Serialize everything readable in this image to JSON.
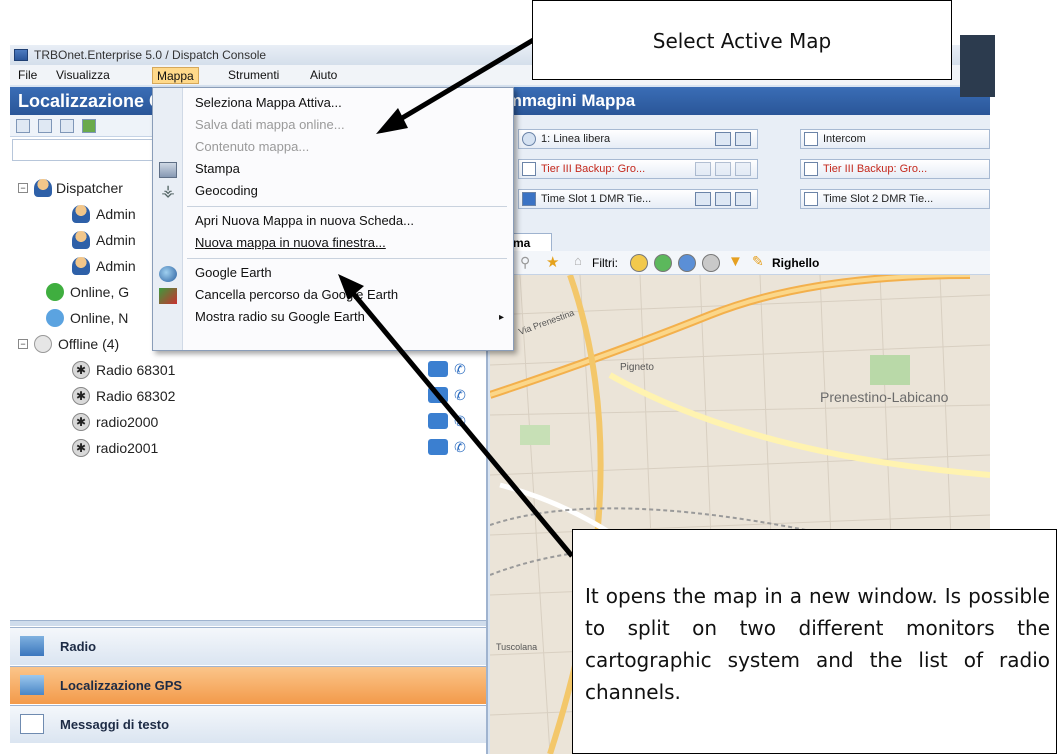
{
  "window": {
    "title": "TRBOnet.Enterprise 5.0 / Dispatch Console"
  },
  "menubar": {
    "items": [
      "File",
      "Visualizza",
      "Mappa",
      "Strumenti",
      "Aiuto"
    ]
  },
  "left_panel": {
    "title": "Localizzazione GPS",
    "tree": {
      "dispatcher_group": "Dispatcher",
      "admins": [
        "Admin",
        "Admin",
        "Admin"
      ],
      "online_groups": [
        "Online, G",
        "Online, N"
      ],
      "offline_group": "Offline (4)",
      "radios": [
        "Radio 68301",
        "Radio 68302",
        "radio2000",
        "radio2001"
      ]
    },
    "bottom_tabs": [
      "Radio",
      "Localizzazione GPS",
      "Messaggi di testo"
    ]
  },
  "right_panel": {
    "title": "Immagini Mappa",
    "channels": [
      {
        "label": "1: Linea libera",
        "style": "normal",
        "checked": false
      },
      {
        "label": "Intercom",
        "style": "normal",
        "checked": false
      },
      {
        "label": "Tier III Backup: Gro...",
        "style": "red",
        "checked": false
      },
      {
        "label": "Tier III Backup: Gro...",
        "style": "red",
        "checked": false
      },
      {
        "label": "Time Slot 1 DMR Tie...",
        "style": "normal",
        "checked": true
      },
      {
        "label": "Time Slot 2 DMR Tie...",
        "style": "normal",
        "checked": false
      }
    ],
    "map_tab": "Roma",
    "map_toolbar": {
      "filter_label": "Filtri:",
      "ruler_label": "Righello"
    },
    "map_labels": [
      "Prenestino-Labicano",
      "Pigneto",
      "Tuscolana",
      "Via Prenestina"
    ]
  },
  "dropdown_menu": {
    "items": [
      {
        "label": "Seleziona Mappa Attiva...",
        "disabled": false,
        "icon": ""
      },
      {
        "label": "Salva dati mappa online...",
        "disabled": true,
        "icon": ""
      },
      {
        "label": "Contenuto mappa...",
        "disabled": true,
        "icon": ""
      },
      {
        "label": "Stampa",
        "disabled": false,
        "icon": "printer-icon"
      },
      {
        "label": "Geocoding",
        "disabled": false,
        "icon": "geocoding-icon"
      },
      {
        "label": "Apri Nuova Mappa in nuova Scheda...",
        "disabled": false,
        "icon": ""
      },
      {
        "label": "Nuova mappa in nuova finestra...",
        "disabled": false,
        "icon": ""
      },
      {
        "label": "Google Earth",
        "disabled": false,
        "icon": "google-earth-icon"
      },
      {
        "label": "Cancella percorso da Google Earth",
        "disabled": false,
        "icon": "google-earth-clear-icon"
      },
      {
        "label": "Mostra radio su Google Earth",
        "disabled": false,
        "icon": ""
      }
    ]
  },
  "callouts": {
    "top": "Select Active Map",
    "bottom": "It opens the map in a new window. Is possible to split on two different monitors the cartographic system and the list of radio channels."
  },
  "colors": {
    "header_blue": "#2f5fa6",
    "active_tab": "#f6a85a",
    "callout_arrow": "#000000"
  }
}
